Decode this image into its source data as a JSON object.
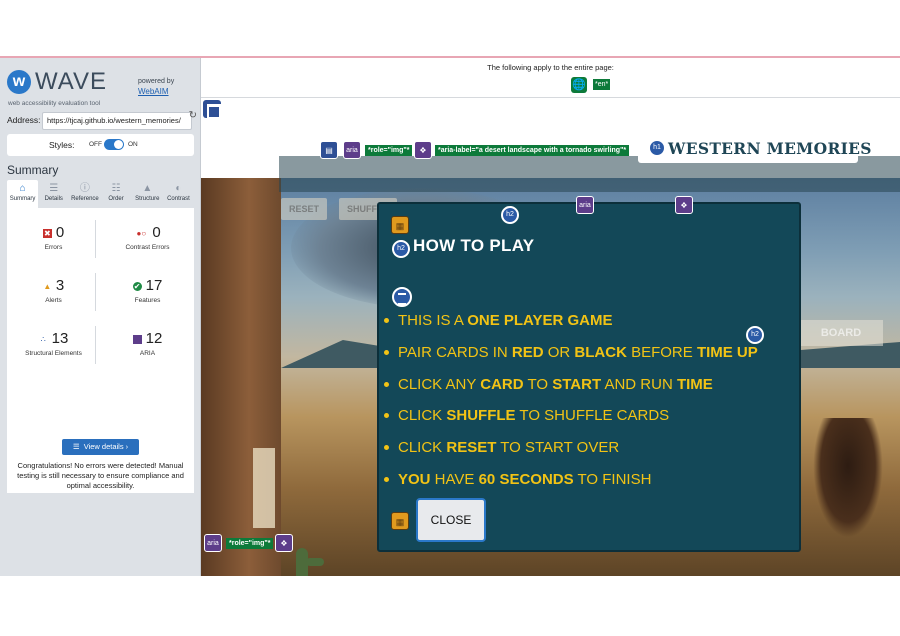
{
  "wave": {
    "logo_text": "WAVE",
    "logo_badge": "w",
    "tagline": "web accessibility evaluation tool",
    "powered_by": "powered by",
    "webaim": "WebAIM",
    "address_label": "Address:",
    "address_value": "https://tjcaj.github.io/western_memories/",
    "styles_label": "Styles:",
    "styles_off": "OFF",
    "styles_on": "ON",
    "summary_title": "Summary",
    "tabs": [
      {
        "label": "Summary",
        "icon": "home-icon"
      },
      {
        "label": "Details",
        "icon": "list-icon"
      },
      {
        "label": "Reference",
        "icon": "info-icon"
      },
      {
        "label": "Order",
        "icon": "order-icon"
      },
      {
        "label": "Structure",
        "icon": "structure-icon"
      },
      {
        "label": "Contrast",
        "icon": "contrast-icon"
      }
    ],
    "stats": {
      "errors": {
        "value": "0",
        "label": "Errors"
      },
      "contrast_errors": {
        "value": "0",
        "label": "Contrast Errors"
      },
      "alerts": {
        "value": "3",
        "label": "Alerts"
      },
      "features": {
        "value": "17",
        "label": "Features"
      },
      "structural": {
        "value": "13",
        "label": "Structural Elements"
      },
      "aria": {
        "value": "12",
        "label": "ARIA"
      }
    },
    "view_details": "View details ›",
    "congrats": "Congratulations! No errors were detected! Manual testing is still necessary to ensure compliance and optimal accessibility."
  },
  "page_bar": {
    "text": "The following apply to the entire page:",
    "lang": "*en*"
  },
  "markers": {
    "aria": "aria",
    "role_img": "*role=\"img\"*",
    "aria_label": "*aria-label=\"a desert landscape with a tornado swirling\"*",
    "h1": "h1",
    "h2": "h2"
  },
  "game": {
    "title": "WESTERN MEMORIES",
    "reset": "RESET",
    "shuffle": "SHUFFLE",
    "board": "BOARD"
  },
  "modal": {
    "title": "HOW TO PLAY",
    "rules": [
      {
        "a": "THIS IS A ",
        "b": "ONE PLAYER GAME",
        "c": "",
        "d": "",
        "e": "",
        "f": ""
      },
      {
        "a": "PAIR CARDS IN ",
        "b": "RED",
        "c": " OR ",
        "d": "BLACK",
        "e": " BEFORE ",
        "f": "TIME UP"
      },
      {
        "a": "CLICK ANY ",
        "b": "CARD",
        "c": " TO ",
        "d": "START",
        "e": " AND RUN ",
        "f": "TIME"
      },
      {
        "a": "CLICK ",
        "b": "SHUFFLE",
        "c": " TO SHUFFLE CARDS",
        "d": "",
        "e": "",
        "f": ""
      },
      {
        "a": "CLICK ",
        "b": "RESET",
        "c": " TO START OVER",
        "d": "",
        "e": "",
        "f": ""
      },
      {
        "a": "",
        "b": "YOU",
        "c": " HAVE ",
        "d": "60 SECONDS",
        "e": " TO FINISH",
        "f": ""
      }
    ],
    "close": "CLOSE"
  }
}
